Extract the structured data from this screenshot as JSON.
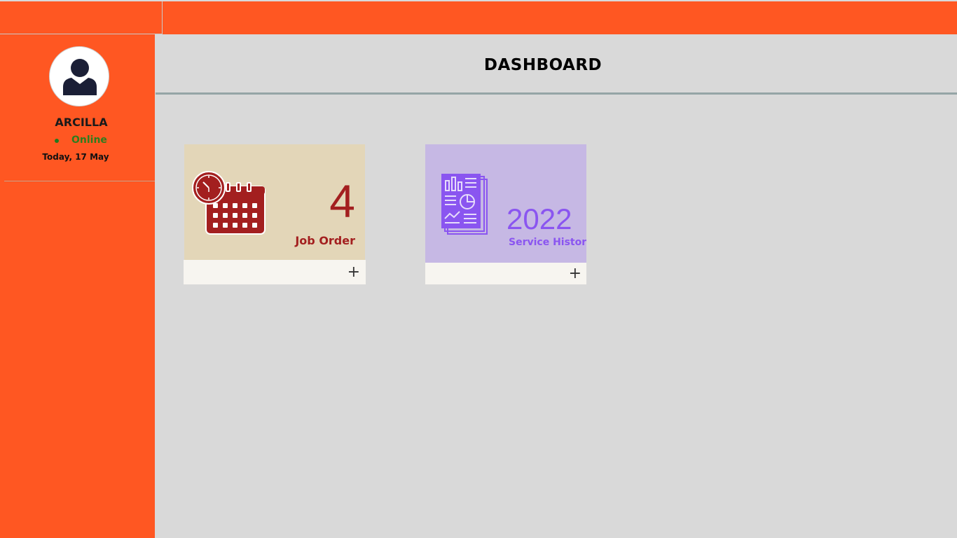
{
  "header": {
    "page_title": "DASHBOARD"
  },
  "sidebar": {
    "username": "ARCILLA",
    "status": "Online",
    "date": "Today, 17 May"
  },
  "cards": [
    {
      "value": "4",
      "label": "Job Order",
      "icon": "calendar-clock-icon",
      "action": "+",
      "accent": "#a31f1f",
      "background": "#e3d6b8"
    },
    {
      "value": "2022",
      "label": "Service History",
      "icon": "report-icon",
      "action": "+",
      "accent": "#8a55f0",
      "background": "#c6b8e4"
    }
  ],
  "colors": {
    "brand": "#ff5722",
    "content_bg": "#d9d9d9",
    "status_online": "#2e7d1e"
  }
}
